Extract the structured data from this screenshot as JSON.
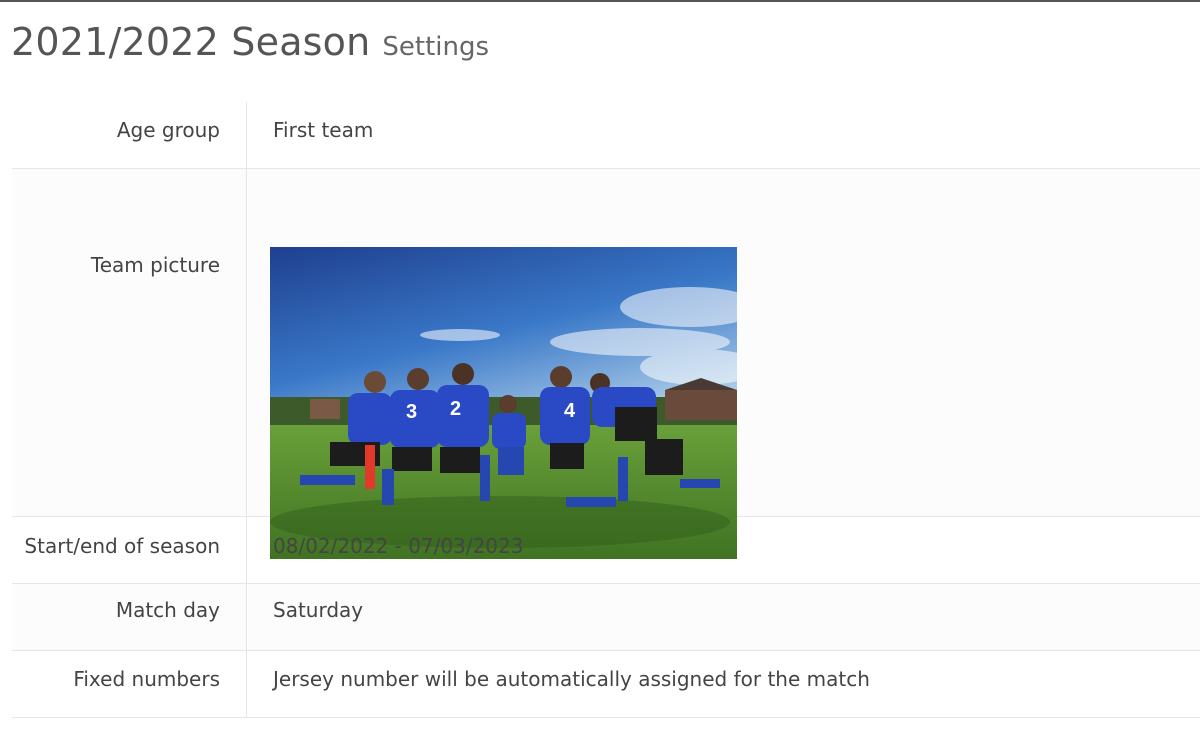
{
  "header": {
    "title": "2021/2022 Season",
    "subtitle": "Settings"
  },
  "settings": {
    "age_group": {
      "label": "Age group",
      "value": "First team"
    },
    "team_picture": {
      "label": "Team picture"
    },
    "season_dates": {
      "label": "Start/end of season",
      "value": "08/02/2022 - 07/03/2023"
    },
    "match_day": {
      "label": "Match day",
      "value": "Saturday"
    },
    "fixed_numbers": {
      "label": "Fixed numbers",
      "value": "Jersey number will be automatically assigned for the match"
    }
  },
  "photo": {
    "jersey_numbers": [
      "3",
      "2",
      "4"
    ],
    "colors": {
      "sky": "#2f62b3",
      "grass": "#4f8a2a",
      "jersey": "#2a49c4"
    }
  }
}
